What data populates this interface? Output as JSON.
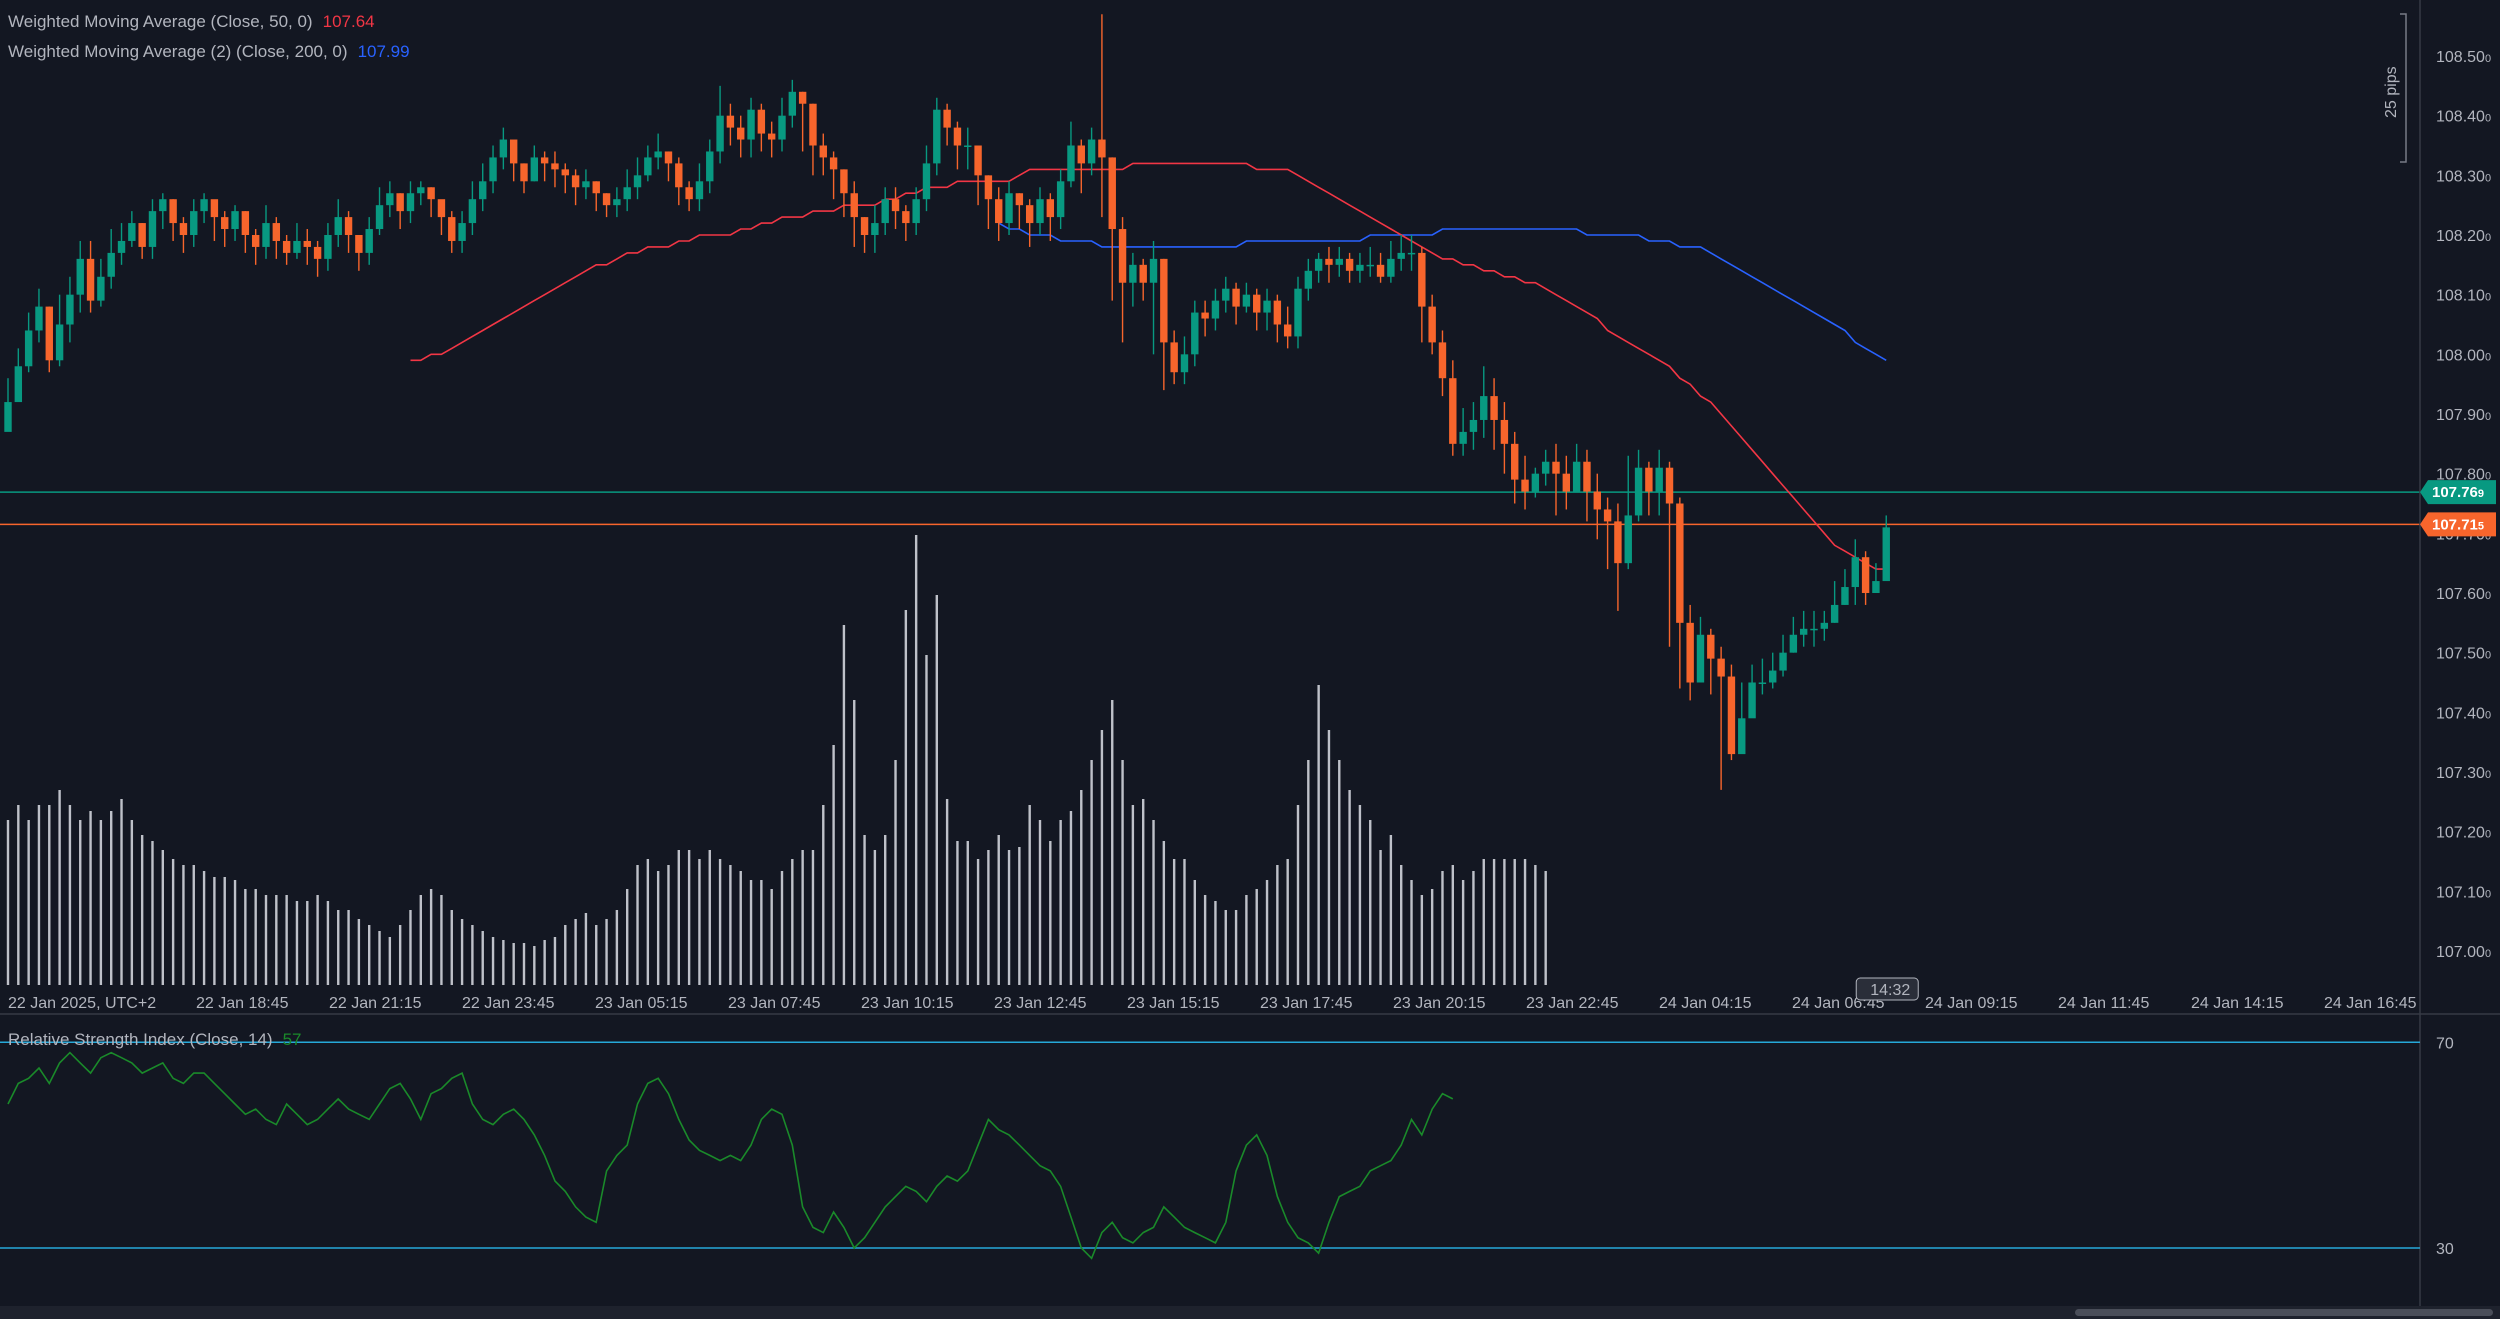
{
  "legend": {
    "wma50_label": "Weighted Moving Average (Close, 50, 0)",
    "wma50_value": "107.64",
    "wma200_label": "Weighted Moving Average (2) (Close, 200, 0)",
    "wma200_value": "107.99",
    "rsi_label": "Relative Strength Index (Close, 14)",
    "rsi_value": "57"
  },
  "colors": {
    "background": "#131722",
    "up": "#089981",
    "down": "#f7652c",
    "wma50": "#f23645",
    "wma200": "#2962ff",
    "rsi": "#1a8a2a",
    "rsi_band": "#26a9d9",
    "support": "#089981",
    "current": "#f7652c",
    "volume": "#d1d4dc"
  },
  "price_tags": {
    "support": "107.76",
    "support_sub": "9",
    "current": "107.71",
    "current_sub": "5"
  },
  "pips_label": "25 pips",
  "cursor_time": "14:32",
  "chart_data": {
    "type": "candlestick",
    "price_axis": {
      "ticks": [
        "108.50",
        "108.40",
        "108.30",
        "108.20",
        "108.10",
        "108.00",
        "107.90",
        "107.80",
        "107.70",
        "107.60",
        "107.50",
        "107.40",
        "107.30",
        "107.20",
        "107.10",
        "107.00"
      ],
      "tick_suffix": "0",
      "range": [
        106.935,
        108.585
      ]
    },
    "time_axis": [
      "22 Jan 2025, UTC+2",
      "22 Jan 18:45",
      "22 Jan 21:15",
      "22 Jan 23:45",
      "23 Jan 05:15",
      "23 Jan 07:45",
      "23 Jan 10:15",
      "23 Jan 12:45",
      "23 Jan 15:15",
      "23 Jan 17:45",
      "23 Jan 20:15",
      "23 Jan 22:45",
      "24 Jan 04:15",
      "24 Jan 06:45",
      "24 Jan 09:15",
      "24 Jan 11:45",
      "24 Jan 14:15",
      "24 Jan 16:45"
    ],
    "horizontal_lines": [
      {
        "name": "support",
        "price": 107.769
      },
      {
        "name": "current",
        "price": 107.715
      }
    ],
    "closes": [
      107.92,
      107.98,
      108.04,
      108.08,
      107.99,
      108.05,
      108.1,
      108.16,
      108.09,
      108.13,
      108.17,
      108.19,
      108.22,
      108.18,
      108.24,
      108.26,
      108.22,
      108.2,
      108.24,
      108.26,
      108.23,
      108.21,
      108.24,
      108.2,
      108.18,
      108.22,
      108.19,
      108.17,
      108.19,
      108.18,
      108.16,
      108.2,
      108.23,
      108.2,
      108.17,
      108.21,
      108.25,
      108.27,
      108.24,
      108.27,
      108.28,
      108.26,
      108.23,
      108.19,
      108.22,
      108.26,
      108.29,
      108.33,
      108.36,
      108.32,
      108.29,
      108.33,
      108.32,
      108.31,
      108.3,
      108.28,
      108.29,
      108.27,
      108.25,
      108.26,
      108.28,
      108.3,
      108.33,
      108.34,
      108.32,
      108.28,
      108.26,
      108.29,
      108.34,
      108.4,
      108.38,
      108.36,
      108.41,
      108.37,
      108.36,
      108.4,
      108.44,
      108.42,
      108.35,
      108.33,
      108.31,
      108.27,
      108.23,
      108.2,
      108.22,
      108.26,
      108.24,
      108.22,
      108.26,
      108.32,
      108.41,
      108.38,
      108.35,
      108.35,
      108.3,
      108.26,
      108.22,
      108.27,
      108.25,
      108.22,
      108.26,
      108.23,
      108.29,
      108.35,
      108.32,
      108.36,
      108.33,
      108.21,
      108.12,
      108.15,
      108.12,
      108.16,
      108.02,
      107.97,
      108.0,
      108.07,
      108.06,
      108.09,
      108.11,
      108.08,
      108.1,
      108.07,
      108.09,
      108.05,
      108.03,
      108.11,
      108.14,
      108.16,
      108.15,
      108.16,
      108.14,
      108.15,
      108.15,
      108.13,
      108.16,
      108.17,
      108.17,
      108.08,
      108.02,
      107.96,
      107.85,
      107.87,
      107.89,
      107.93,
      107.89,
      107.85,
      107.79,
      107.77,
      107.8,
      107.82,
      107.8,
      107.77,
      107.82,
      107.77,
      107.74,
      107.72,
      107.65,
      107.73,
      107.81,
      107.77,
      107.81,
      107.75,
      107.55,
      107.45,
      107.53,
      107.49,
      107.46,
      107.33,
      107.39,
      107.45,
      107.45,
      107.47,
      107.5,
      107.53,
      107.54,
      107.54,
      107.55,
      107.58,
      107.61,
      107.66,
      107.6,
      107.62,
      107.71
    ],
    "highs": [
      107.96,
      108.01,
      108.07,
      108.11,
      108.08,
      108.1,
      108.13,
      108.19,
      108.19,
      108.16,
      108.21,
      108.22,
      108.24,
      108.22,
      108.26,
      108.27,
      108.26,
      108.23,
      108.26,
      108.27,
      108.25,
      108.24,
      108.25,
      108.24,
      108.21,
      108.25,
      108.23,
      108.2,
      108.22,
      108.21,
      108.19,
      108.22,
      108.26,
      108.24,
      108.2,
      108.23,
      108.28,
      108.29,
      108.27,
      108.29,
      108.29,
      108.28,
      108.25,
      108.24,
      108.24,
      108.29,
      108.32,
      108.35,
      108.38,
      108.35,
      108.32,
      108.35,
      108.34,
      108.34,
      108.32,
      108.31,
      108.31,
      108.29,
      108.27,
      108.28,
      108.31,
      108.33,
      108.35,
      108.37,
      108.34,
      108.33,
      108.29,
      108.32,
      108.36,
      108.45,
      108.42,
      108.4,
      108.43,
      108.42,
      108.39,
      108.43,
      108.46,
      108.44,
      108.42,
      108.37,
      108.34,
      108.31,
      108.29,
      108.23,
      108.25,
      108.28,
      108.28,
      108.25,
      108.28,
      108.35,
      108.43,
      108.42,
      108.39,
      108.38,
      108.35,
      108.3,
      108.28,
      108.29,
      108.27,
      108.26,
      108.28,
      108.27,
      108.31,
      108.39,
      108.36,
      108.38,
      108.57,
      108.33,
      108.23,
      108.17,
      108.16,
      108.19,
      108.16,
      108.04,
      108.03,
      108.09,
      108.09,
      108.11,
      108.13,
      108.12,
      108.12,
      108.11,
      108.11,
      108.1,
      108.08,
      108.13,
      108.16,
      108.17,
      108.18,
      108.18,
      108.17,
      108.17,
      108.18,
      108.17,
      108.19,
      108.2,
      108.2,
      108.18,
      108.1,
      108.04,
      107.99,
      107.91,
      107.92,
      107.98,
      107.96,
      107.92,
      107.87,
      107.83,
      107.81,
      107.84,
      107.85,
      107.83,
      107.85,
      107.84,
      107.8,
      107.76,
      107.75,
      107.83,
      107.84,
      107.82,
      107.84,
      107.82,
      107.76,
      107.58,
      107.56,
      107.54,
      107.51,
      107.48,
      107.45,
      107.48,
      107.49,
      107.5,
      107.53,
      107.56,
      107.57,
      107.57,
      107.57,
      107.62,
      107.64,
      107.69,
      107.67,
      107.65,
      107.73
    ],
    "lows": [
      107.88,
      107.93,
      107.97,
      108.02,
      107.97,
      107.98,
      108.02,
      108.07,
      108.07,
      108.08,
      108.11,
      108.15,
      108.18,
      108.16,
      108.16,
      108.21,
      108.19,
      108.17,
      108.18,
      108.22,
      108.19,
      108.18,
      108.19,
      108.17,
      108.15,
      108.16,
      108.16,
      108.15,
      108.16,
      108.15,
      108.13,
      108.14,
      108.18,
      108.17,
      108.14,
      108.15,
      108.2,
      108.23,
      108.21,
      108.22,
      108.25,
      108.23,
      108.2,
      108.17,
      108.17,
      108.2,
      108.24,
      108.27,
      108.31,
      108.29,
      108.27,
      108.29,
      108.29,
      108.28,
      108.27,
      108.25,
      108.26,
      108.24,
      108.23,
      108.23,
      108.24,
      108.26,
      108.29,
      108.31,
      108.29,
      108.25,
      108.24,
      108.24,
      108.27,
      108.32,
      108.35,
      108.33,
      108.33,
      108.34,
      108.33,
      108.34,
      108.38,
      108.34,
      108.3,
      108.3,
      108.26,
      108.23,
      108.18,
      108.17,
      108.17,
      108.2,
      108.21,
      108.19,
      108.2,
      108.24,
      108.3,
      108.35,
      108.31,
      108.31,
      108.25,
      108.21,
      108.19,
      108.2,
      108.21,
      108.18,
      108.2,
      108.19,
      108.21,
      108.28,
      108.27,
      108.3,
      108.23,
      108.09,
      108.02,
      108.08,
      108.09,
      108.0,
      107.94,
      107.95,
      107.95,
      107.98,
      108.03,
      108.04,
      108.07,
      108.05,
      108.07,
      108.04,
      108.04,
      108.02,
      108.01,
      108.01,
      108.09,
      108.12,
      108.12,
      108.13,
      108.12,
      108.12,
      108.13,
      108.12,
      108.12,
      108.14,
      108.14,
      108.02,
      108.0,
      107.93,
      107.83,
      107.83,
      107.84,
      107.86,
      107.84,
      107.8,
      107.75,
      107.74,
      107.76,
      107.78,
      107.73,
      107.74,
      107.77,
      107.72,
      107.69,
      107.64,
      107.57,
      107.64,
      107.72,
      107.73,
      107.73,
      107.51,
      107.44,
      107.42,
      107.45,
      107.43,
      107.27,
      107.32,
      107.37,
      107.43,
      107.43,
      107.44,
      107.46,
      107.5,
      107.51,
      107.51,
      107.52,
      107.55,
      107.58,
      107.58,
      107.58,
      107.6,
      107.69
    ],
    "wma50": [
      107.99,
      107.99,
      108.0,
      108.0,
      108.01,
      108.02,
      108.03,
      108.04,
      108.05,
      108.06,
      108.07,
      108.08,
      108.09,
      108.1,
      108.11,
      108.12,
      108.13,
      108.14,
      108.15,
      108.15,
      108.16,
      108.17,
      108.17,
      108.18,
      108.18,
      108.18,
      108.19,
      108.19,
      108.2,
      108.2,
      108.2,
      108.2,
      108.21,
      108.21,
      108.22,
      108.22,
      108.23,
      108.23,
      108.23,
      108.24,
      108.24,
      108.24,
      108.25,
      108.25,
      108.25,
      108.25,
      108.26,
      108.26,
      108.27,
      108.27,
      108.28,
      108.28,
      108.28,
      108.29,
      108.29,
      108.29,
      108.29,
      108.29,
      108.29,
      108.3,
      108.31,
      108.31,
      108.31,
      108.31,
      108.31,
      108.31,
      108.31,
      108.31,
      108.31,
      108.31,
      108.32,
      108.32,
      108.32,
      108.32,
      108.32,
      108.32,
      108.32,
      108.32,
      108.32,
      108.32,
      108.32,
      108.32,
      108.31,
      108.31,
      108.31,
      108.31,
      108.3,
      108.29,
      108.28,
      108.27,
      108.26,
      108.25,
      108.24,
      108.23,
      108.22,
      108.21,
      108.2,
      108.19,
      108.18,
      108.17,
      108.16,
      108.16,
      108.15,
      108.15,
      108.14,
      108.14,
      108.13,
      108.13,
      108.12,
      108.12,
      108.11,
      108.1,
      108.09,
      108.08,
      108.07,
      108.06,
      108.04,
      108.03,
      108.02,
      108.01,
      108.0,
      107.99,
      107.98,
      107.96,
      107.95,
      107.93,
      107.92,
      107.9,
      107.88,
      107.86,
      107.84,
      107.82,
      107.8,
      107.78,
      107.76,
      107.74,
      107.72,
      107.7,
      107.68,
      107.67,
      107.66,
      107.65,
      107.64,
      107.64
    ],
    "wma200": [
      108.22,
      108.21,
      108.21,
      108.2,
      108.2,
      108.2,
      108.19,
      108.19,
      108.19,
      108.19,
      108.18,
      108.18,
      108.18,
      108.18,
      108.18,
      108.18,
      108.18,
      108.18,
      108.18,
      108.18,
      108.18,
      108.18,
      108.18,
      108.18,
      108.19,
      108.19,
      108.19,
      108.19,
      108.19,
      108.19,
      108.19,
      108.19,
      108.19,
      108.19,
      108.19,
      108.19,
      108.2,
      108.2,
      108.2,
      108.2,
      108.2,
      108.2,
      108.2,
      108.21,
      108.21,
      108.21,
      108.21,
      108.21,
      108.21,
      108.21,
      108.21,
      108.21,
      108.21,
      108.21,
      108.21,
      108.21,
      108.21,
      108.2,
      108.2,
      108.2,
      108.2,
      108.2,
      108.2,
      108.19,
      108.19,
      108.19,
      108.18,
      108.18,
      108.18,
      108.17,
      108.16,
      108.15,
      108.14,
      108.13,
      108.12,
      108.11,
      108.1,
      108.09,
      108.08,
      108.07,
      108.06,
      108.05,
      108.04,
      108.02,
      108.01,
      108.0,
      107.99
    ],
    "volume": [
      55,
      60,
      55,
      60,
      60,
      65,
      60,
      55,
      58,
      55,
      58,
      62,
      55,
      50,
      48,
      45,
      42,
      40,
      40,
      38,
      36,
      36,
      35,
      32,
      32,
      30,
      30,
      30,
      28,
      28,
      30,
      28,
      25,
      25,
      22,
      20,
      18,
      16,
      20,
      25,
      30,
      32,
      30,
      25,
      22,
      20,
      18,
      16,
      15,
      14,
      14,
      13,
      15,
      16,
      20,
      22,
      24,
      20,
      22,
      25,
      32,
      40,
      42,
      38,
      40,
      45,
      45,
      42,
      45,
      42,
      40,
      38,
      35,
      35,
      32,
      38,
      42,
      45,
      45,
      60,
      80,
      120,
      95,
      50,
      45,
      50,
      75,
      125,
      150,
      110,
      130,
      62,
      48,
      48,
      42,
      45,
      50,
      45,
      46,
      60,
      55,
      48,
      55,
      58,
      65,
      75,
      85,
      95,
      75,
      60,
      62,
      55,
      48,
      42,
      42,
      35,
      30,
      28,
      25,
      25,
      30,
      32,
      35,
      40,
      42,
      60,
      75,
      100,
      85,
      75,
      65,
      60,
      55,
      45,
      50,
      40,
      35,
      30,
      32,
      38,
      40,
      35,
      38,
      42,
      42,
      42,
      42,
      42,
      40,
      38
    ],
    "rsi": {
      "ticks": [
        "70",
        "30"
      ],
      "values": [
        58,
        62,
        63,
        65,
        62,
        66,
        68,
        66,
        64,
        67,
        68,
        67,
        66,
        64,
        65,
        66,
        63,
        62,
        64,
        64,
        62,
        60,
        58,
        56,
        57,
        55,
        54,
        58,
        56,
        54,
        55,
        57,
        59,
        57,
        56,
        55,
        58,
        61,
        62,
        59,
        55,
        60,
        61,
        63,
        64,
        58,
        55,
        54,
        56,
        57,
        55,
        52,
        48,
        43,
        41,
        38,
        36,
        35,
        45,
        48,
        50,
        58,
        62,
        63,
        60,
        55,
        51,
        49,
        48,
        47,
        48,
        47,
        50,
        55,
        57,
        56,
        50,
        38,
        34,
        33,
        37,
        34,
        30,
        32,
        35,
        38,
        40,
        42,
        41,
        39,
        42,
        44,
        43,
        45,
        50,
        55,
        53,
        52,
        50,
        48,
        46,
        45,
        42,
        36,
        30,
        28,
        33,
        35,
        32,
        31,
        33,
        34,
        38,
        36,
        34,
        33,
        32,
        31,
        35,
        45,
        50,
        52,
        48,
        40,
        35,
        32,
        31,
        29,
        35,
        40,
        41,
        42,
        45,
        46,
        47,
        50,
        55,
        52,
        57,
        60,
        59
      ]
    }
  }
}
